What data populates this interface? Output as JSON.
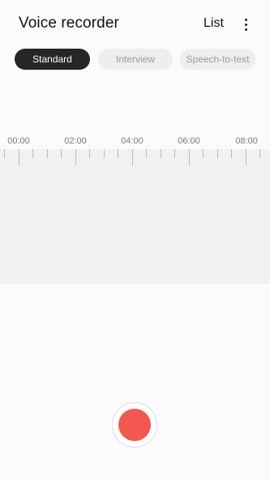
{
  "header": {
    "title": "Voice recorder",
    "list_label": "List",
    "more_icon": "more-vertical-icon"
  },
  "tabs": [
    {
      "label": "Standard",
      "selected": true
    },
    {
      "label": "Interview",
      "selected": false
    },
    {
      "label": "Speech-to-text",
      "selected": false
    }
  ],
  "timeline": {
    "time_labels": [
      "00:00",
      "02:00",
      "04:00",
      "06:00",
      "08:00"
    ]
  },
  "record_button": {
    "icon": "record-icon",
    "color": "#f25750"
  },
  "colors": {
    "background": "#fcfafc",
    "active_tab": "#262628",
    "inactive_tab": "#efedf0",
    "waveform_area": "#f2f1f2",
    "record": "#f25750"
  }
}
